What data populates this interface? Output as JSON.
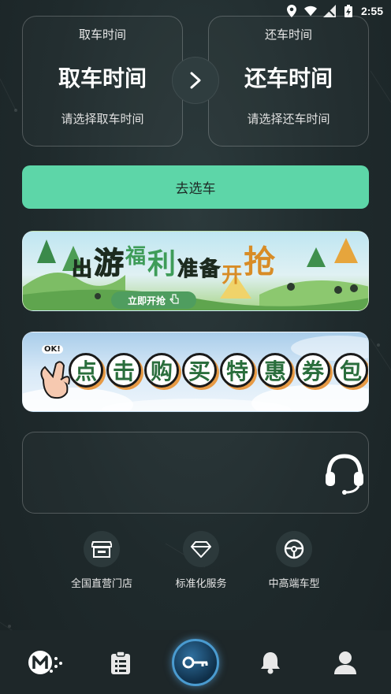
{
  "status_bar": {
    "time": "2:55"
  },
  "pickup": {
    "caption": "取车时间",
    "title": "取车时间",
    "hint": "请选择取车时间"
  },
  "return": {
    "caption": "还车时间",
    "title": "还车时间",
    "hint": "请选择还车时间"
  },
  "select_car_button": "去选车",
  "banner1": {
    "title_chars": [
      "出",
      "游",
      "福",
      "利",
      "准",
      "备",
      "开",
      "抢"
    ],
    "pill_label": "立即开抢"
  },
  "banner2": {
    "ok_text": "OK!",
    "title_chars": [
      "点",
      "击",
      "购",
      "买",
      "特",
      "惠",
      "券",
      "包"
    ]
  },
  "features": [
    {
      "label": "全国直营门店",
      "icon": "store-icon"
    },
    {
      "label": "标准化服务",
      "icon": "diamond-icon"
    },
    {
      "label": "中高端车型",
      "icon": "steering-wheel-icon"
    }
  ],
  "tabbar": {
    "items": [
      "home-logo-icon",
      "clipboard-list-icon",
      "car-key-icon",
      "bell-icon",
      "user-icon"
    ]
  },
  "colors": {
    "accent": "#5dd6a8",
    "background": "#1f2a2c",
    "tab_center": "#4a9bd0"
  }
}
